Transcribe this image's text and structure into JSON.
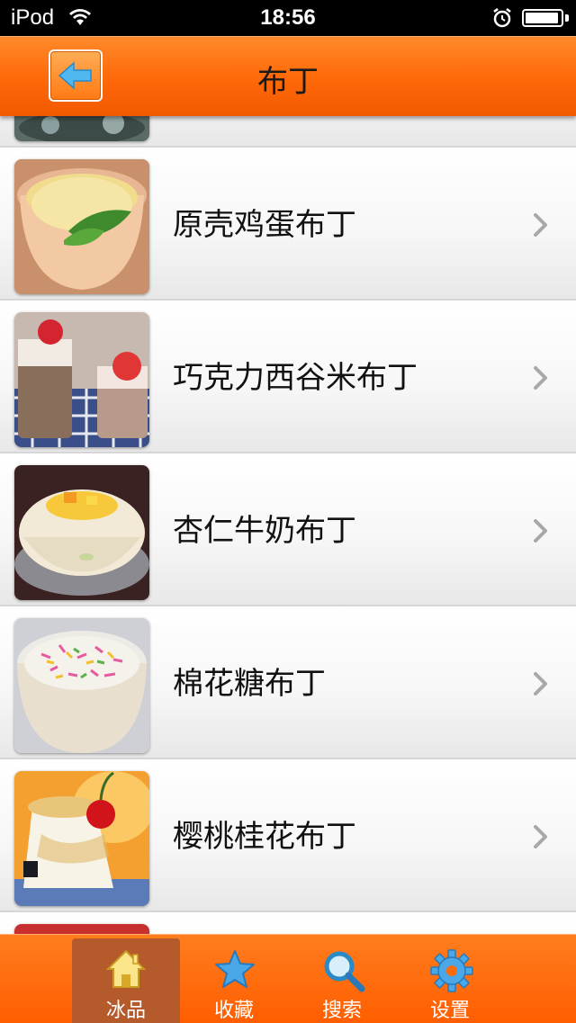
{
  "status_bar": {
    "carrier": "iPod",
    "time": "18:56",
    "battery_level": 0.95
  },
  "nav": {
    "title": "布丁",
    "back_icon": "back-arrow-icon"
  },
  "list": {
    "items": [
      {
        "label": ""
      },
      {
        "label": "原壳鸡蛋布丁"
      },
      {
        "label": "巧克力西谷米布丁"
      },
      {
        "label": "杏仁牛奶布丁"
      },
      {
        "label": "棉花糖布丁"
      },
      {
        "label": "樱桃桂花布丁"
      },
      {
        "label": ""
      }
    ]
  },
  "tabs": [
    {
      "label": "冰品",
      "icon": "home-icon",
      "active": true
    },
    {
      "label": "收藏",
      "icon": "star-icon",
      "active": false
    },
    {
      "label": "搜索",
      "icon": "search-icon",
      "active": false
    },
    {
      "label": "设置",
      "icon": "gear-icon",
      "active": false
    }
  ],
  "colors": {
    "accent": "#ff6a0a",
    "active_tab": "#b55a2a"
  }
}
